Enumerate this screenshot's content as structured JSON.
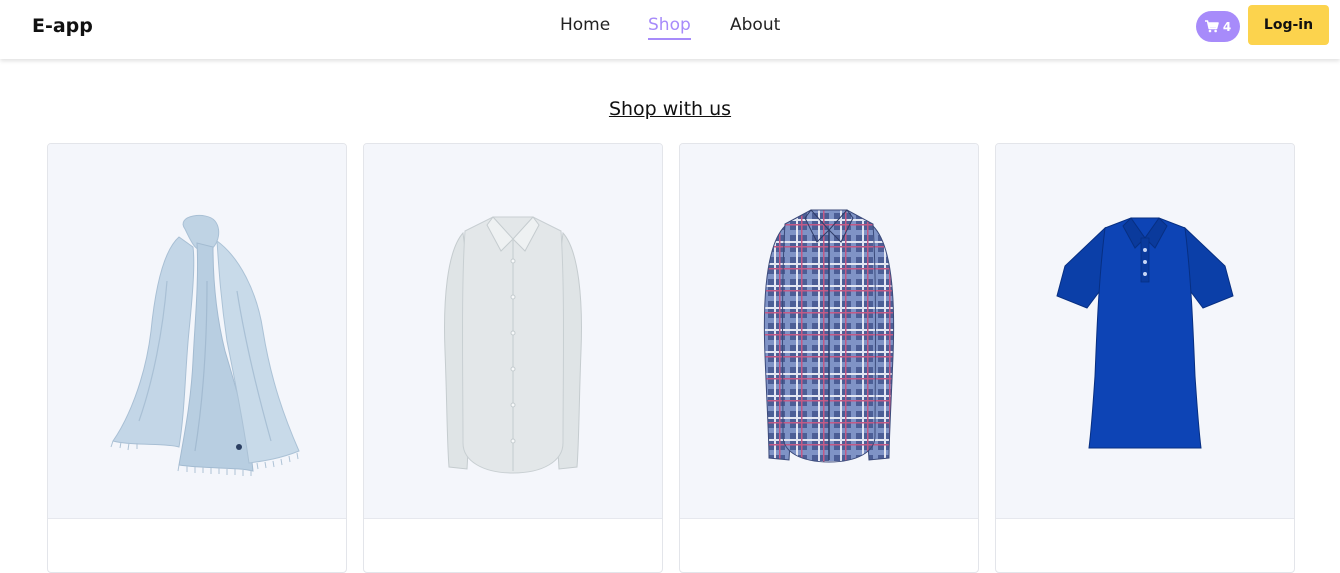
{
  "navbar": {
    "brand": "E-app",
    "links": [
      {
        "label": "Home"
      },
      {
        "label": "Shop",
        "active": true
      },
      {
        "label": "About"
      }
    ],
    "cart_count": "4",
    "login_label": "Log-in",
    "accent_color": "#a78bfa",
    "login_color": "#fcd34d"
  },
  "main": {
    "title": "Shop with us",
    "products": [
      {
        "name": "",
        "icon": "scarf-image"
      },
      {
        "name": "",
        "icon": "white-shirt-image"
      },
      {
        "name": "",
        "icon": "plaid-shirt-image"
      },
      {
        "name": "",
        "icon": "blue-polo-image"
      }
    ]
  }
}
